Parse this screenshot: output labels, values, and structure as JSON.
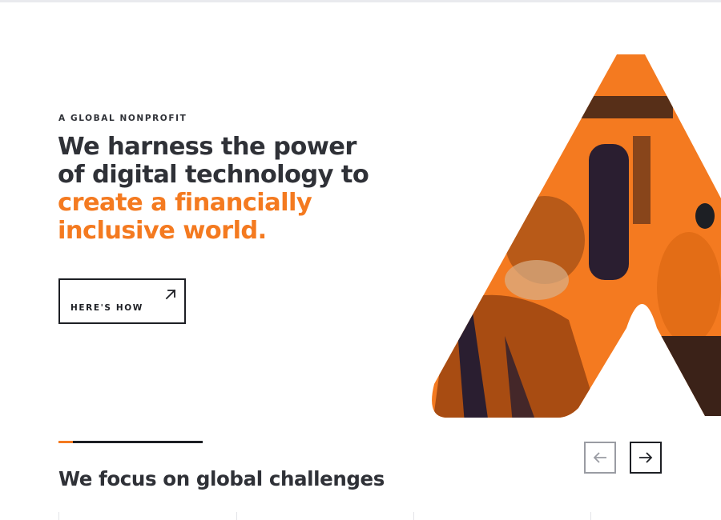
{
  "hero": {
    "eyebrow": "A GLOBAL NONPROFIT",
    "headline_lines": [
      "We harness the power",
      "of digital technology to",
      "create a financially",
      "inclusive world."
    ],
    "cta_label": "HERE'S HOW",
    "cta_icon": "arrow-up-right-icon",
    "image_icon": "stylized-a-logo-photo"
  },
  "carousel": {
    "progress_fraction": 0.1,
    "prev_icon": "arrow-left-icon",
    "next_icon": "arrow-right-icon"
  },
  "section": {
    "title": "We focus on global challenges"
  },
  "colors": {
    "accent": "#f47a20",
    "text": "#2f3137",
    "border": "#1d1f24",
    "muted_border": "#9a9ca3"
  }
}
